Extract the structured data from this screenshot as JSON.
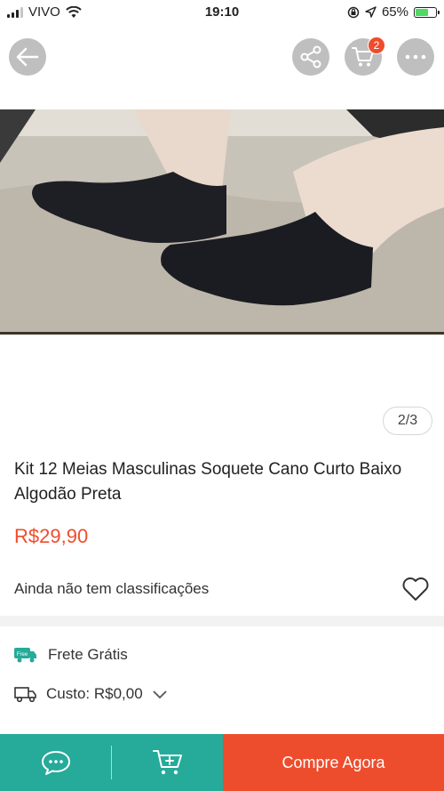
{
  "status_bar": {
    "carrier": "VIVO",
    "time": "19:10",
    "battery": "65%"
  },
  "header": {
    "back_icon": "arrow-left-icon",
    "share_icon": "share-icon",
    "cart_icon": "cart-icon",
    "cart_badge": "2",
    "more_icon": "more-dots-icon"
  },
  "gallery": {
    "counter": "2/3"
  },
  "product": {
    "title": "Kit 12 Meias Masculinas Soquete Cano Curto Baixo Algodão Preta",
    "price": "R$29,90",
    "ratings_text": "Ainda não tem classificações"
  },
  "shipping": {
    "badge": "Free",
    "label": "Frete Grátis",
    "cost_label": "Custo: R$0,00"
  },
  "bottom_bar": {
    "buy_label": "Compre Agora"
  },
  "colors": {
    "accent": "#ee4d2d",
    "teal": "#26aa99"
  }
}
